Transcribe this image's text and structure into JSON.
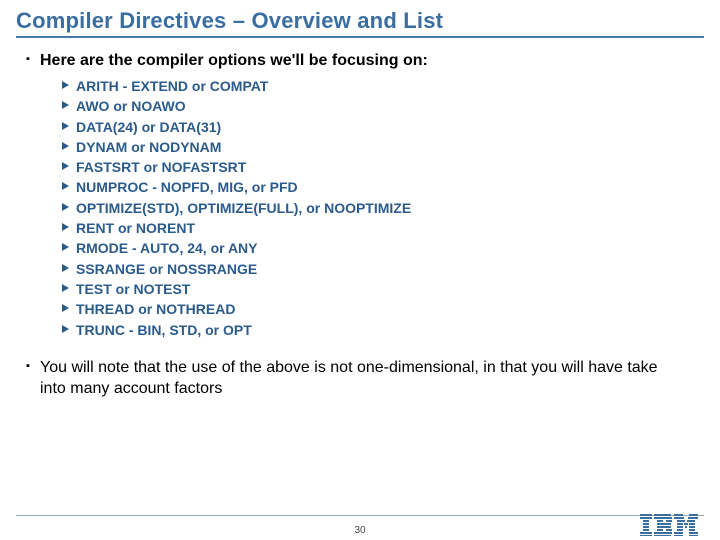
{
  "title": "Compiler Directives – Overview and List",
  "intro": "Here are the compiler options we'll be focusing on:",
  "options": [
    "ARITH - EXTEND or COMPAT",
    "AWO or NOAWO",
    "DATA(24) or DATA(31)",
    "DYNAM or NODYNAM",
    "FASTSRT or NOFASTSRT",
    "NUMPROC - NOPFD, MIG, or PFD",
    "OPTIMIZE(STD), OPTIMIZE(FULL), or NOOPTIMIZE",
    "RENT or NORENT",
    "RMODE - AUTO, 24, or ANY",
    "SSRANGE or NOSSRANGE",
    "TEST or NOTEST",
    "THREAD or NOTHREAD",
    "TRUNC - BIN, STD, or OPT"
  ],
  "closing": "You will note that the use of the above is not one-dimensional, in that you will have take into many account factors",
  "page_number": "30",
  "logo_name": "IBM"
}
